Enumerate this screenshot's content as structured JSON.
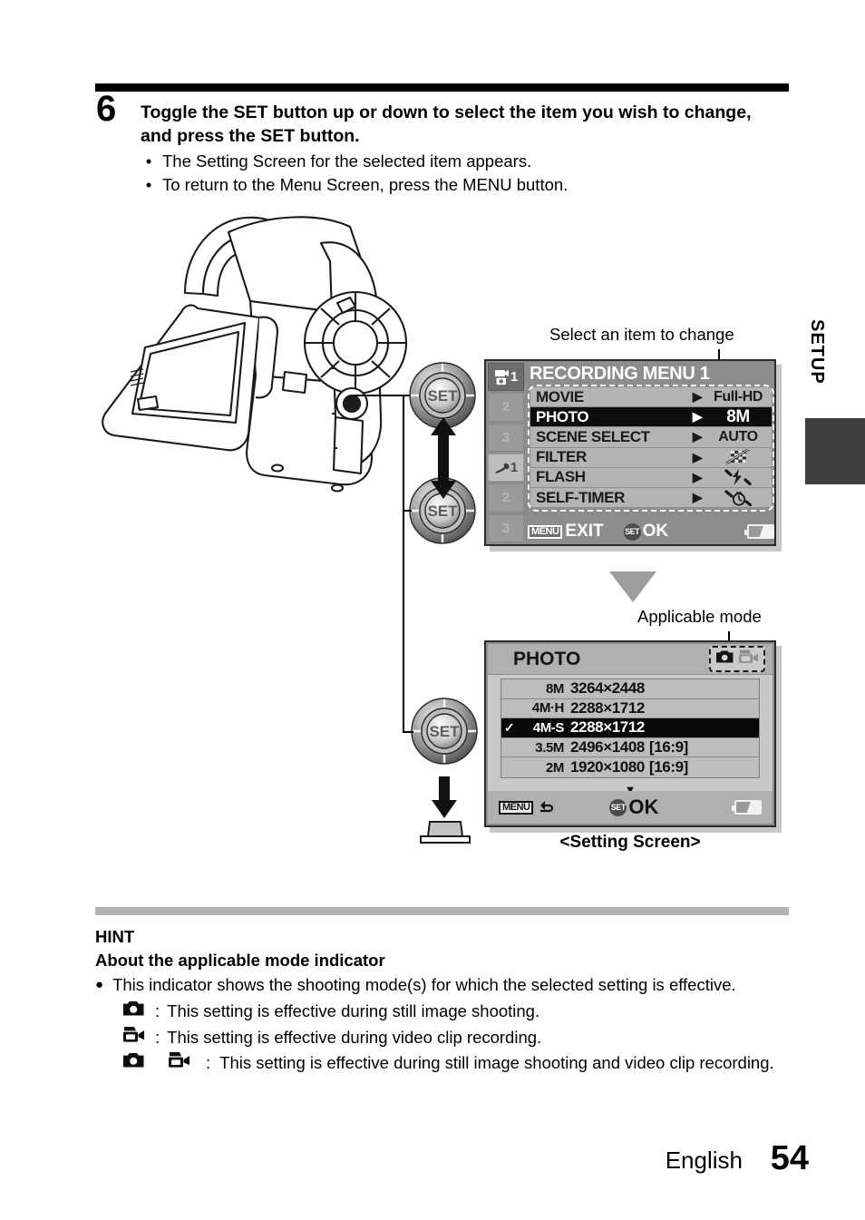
{
  "step": {
    "number": "6",
    "heading": "Toggle the SET button up or down to select the item you wish to change, and press the SET button.",
    "bullets": [
      "The Setting Screen for the selected item appears.",
      "To return to the Menu Screen, press the MENU button."
    ],
    "bullet_dot": "•"
  },
  "side_tab": {
    "label": "SETUP"
  },
  "callouts": {
    "select_item": "Select an item to change",
    "applicable_mode": "Applicable mode",
    "setting_screen_caption": "<Setting Screen>"
  },
  "dials": {
    "set_label": "SET"
  },
  "menu_screen": {
    "title": "RECORDING MENU 1",
    "tabs": [
      {
        "label": "1",
        "icon": "camcorder-camera-icon",
        "state": "active-rec"
      },
      {
        "label": "2",
        "icon": "",
        "state": "inactive"
      },
      {
        "label": "3",
        "icon": "",
        "state": "inactive"
      },
      {
        "label": "1",
        "icon": "wrench-icon",
        "state": "active-set"
      },
      {
        "label": "2",
        "icon": "",
        "state": "inactive"
      },
      {
        "label": "3",
        "icon": "",
        "state": "inactive"
      }
    ],
    "arrow": "▶",
    "rows": [
      {
        "label": "MOVIE",
        "value": "Full-HD",
        "value_icon": "",
        "selected": false
      },
      {
        "label": "PHOTO",
        "value": "8M",
        "value_icon": "",
        "selected": true
      },
      {
        "label": "SCENE SELECT",
        "value": "AUTO",
        "value_icon": "",
        "selected": false
      },
      {
        "label": "FILTER",
        "value": "",
        "value_icon": "filter-off-icon",
        "selected": false
      },
      {
        "label": "FLASH",
        "value": "",
        "value_icon": "flash-auto-icon",
        "selected": false
      },
      {
        "label": "SELF-TIMER",
        "value": "",
        "value_icon": "self-timer-off-icon",
        "selected": false
      }
    ],
    "footer": {
      "menu_key": "MENU",
      "menu_action": "EXIT",
      "set_key": "SET",
      "set_action": "OK",
      "battery_icon": "battery-icon"
    }
  },
  "photo_screen": {
    "title": "PHOTO",
    "mode_indicator": [
      "still-camera-icon",
      "video-camera-icon"
    ],
    "check": "✓",
    "rows": [
      {
        "res": "8M",
        "dimensions": "3264×2448",
        "ratio": "",
        "selected": false,
        "checked": false
      },
      {
        "res": "4M·H",
        "dimensions": "2288×1712",
        "ratio": "",
        "selected": false,
        "checked": false
      },
      {
        "res": "4M-S",
        "dimensions": "2288×1712",
        "ratio": "",
        "selected": true,
        "checked": true
      },
      {
        "res": "3.5M",
        "dimensions": "2496×1408",
        "ratio": "[16:9]",
        "selected": false,
        "checked": false
      },
      {
        "res": "2M",
        "dimensions": "1920×1080",
        "ratio": "[16:9]",
        "selected": false,
        "checked": false
      }
    ],
    "more_arrow": "▼",
    "footer": {
      "menu_key": "MENU",
      "menu_action_icon": "return-arrow-icon",
      "set_key": "SET",
      "set_action": "OK",
      "battery_icon": "battery-icon"
    }
  },
  "hint": {
    "title": "HINT",
    "subtitle": "About the applicable mode indicator",
    "bullet_dot": "●",
    "body": "This indicator shows the shooting mode(s) for which the selected setting is effective.",
    "items": [
      {
        "icons": [
          "still-camera-icon"
        ],
        "colon": ":",
        "text": "This setting is effective during still image shooting."
      },
      {
        "icons": [
          "video-camera-icon"
        ],
        "colon": ":",
        "text": "This setting is effective during video clip recording."
      },
      {
        "icons": [
          "still-camera-icon",
          "video-camera-icon"
        ],
        "colon": ":",
        "text": "This setting is effective during still image shooting and video clip recording."
      }
    ]
  },
  "footer": {
    "language": "English",
    "page": "54"
  },
  "colors": {
    "rule_black": "#000000",
    "rule_gray": "#b3b3b3",
    "lcd_bg": "#8d8d8d",
    "side_tab": "#3e3e3e",
    "selected_row": "#0d0d0d"
  }
}
